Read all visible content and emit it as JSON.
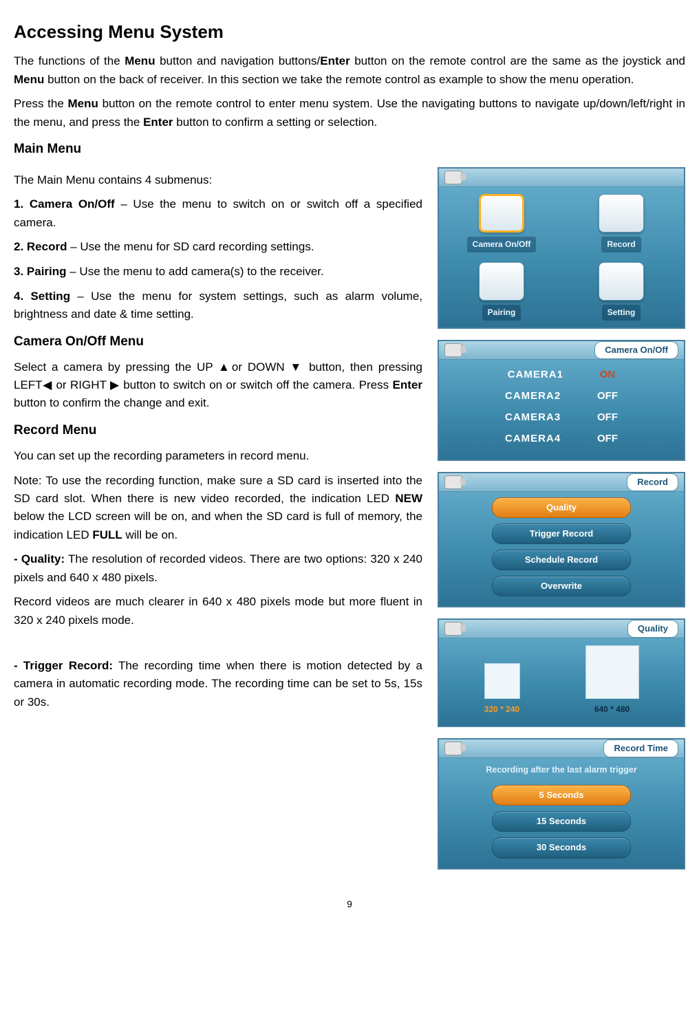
{
  "page_number": "9",
  "title": "Accessing Menu System",
  "intro_p1_run1": "The functions of the ",
  "intro_p1_b1": "Menu",
  "intro_p1_run2": " button and navigation buttons/",
  "intro_p1_b2": "Enter",
  "intro_p1_run3": " button on the remote control are the same as the joystick and ",
  "intro_p1_b3": "Menu",
  "intro_p1_run4": " button on the back of receiver. In this section we take the remote control as example to show the menu operation.",
  "intro_p2_run1": "Press the ",
  "intro_p2_b1": "Menu",
  "intro_p2_run2": " button on the remote control to enter menu system. Use the navigating buttons to navigate up/down/left/right in the menu, and press the ",
  "intro_p2_b2": "Enter",
  "intro_p2_run3": " button to confirm a setting or selection.",
  "h2_main_menu": "Main Menu",
  "main_menu_intro": "The Main Menu contains 4 submenus:",
  "mm_1_b": "1. Camera On/Off",
  "mm_1_t": " – Use the menu to switch on or switch off a specified camera.",
  "mm_2_b": "2. Record",
  "mm_2_t": " – Use the menu for SD card recording settings.",
  "mm_3_b": "3. Pairing",
  "mm_3_t": " – Use the menu to add camera(s) to the receiver.",
  "mm_4_b": "4. Setting",
  "mm_4_t": " – Use the menu for system settings, such as alarm volume, brightness and date & time setting.",
  "h2_cam": "Camera On/Off Menu",
  "cam_p_run1": "Select a camera by pressing the UP ▲or DOWN ▼ button, then pressing LEFT◀ or RIGHT ▶ button to switch on or switch off the camera. Press ",
  "cam_p_b1": "Enter",
  "cam_p_run2": " button to confirm the change and exit.",
  "h2_record": "Record Menu",
  "rec_p1": "You can set up the recording parameters in record menu.",
  "rec_p2_run1": "Note: To use the recording function, make sure a SD card is inserted into the SD card slot. When there is new video recorded, the indication LED ",
  "rec_p2_b1": "NEW",
  "rec_p2_run2": " below the LCD screen will be on, and when the SD card is full of memory, the indication LED ",
  "rec_p2_b2": "FULL",
  "rec_p2_run3": " will be on.",
  "rec_q_b": "- Quality:",
  "rec_q_t": " The resolution of recorded videos. There are two options: 320 x 240 pixels and 640 x 480 pixels.",
  "rec_q2": "Record videos are much clearer in 640 x 480 pixels mode but more fluent in 320 x 240 pixels mode.",
  "rec_tr_b": "- Trigger Record:",
  "rec_tr_t": " The recording time when there is motion detected by a camera in automatic recording mode. The recording time can be set to 5s, 15s or 30s.",
  "screens": {
    "main_menu": {
      "cells": [
        "Camera On/Off",
        "Record",
        "Pairing",
        "Setting"
      ]
    },
    "cam_onoff": {
      "title": "Camera On/Off",
      "rows": [
        {
          "name": "CAMERA1",
          "state": "ON",
          "on": true
        },
        {
          "name": "CAMERA2",
          "state": "OFF",
          "on": false
        },
        {
          "name": "CAMERA3",
          "state": "OFF",
          "on": false
        },
        {
          "name": "CAMERA4",
          "state": "OFF",
          "on": false
        }
      ]
    },
    "record": {
      "title": "Record",
      "items": [
        "Quality",
        "Trigger Record",
        "Schedule Record",
        "Overwrite"
      ]
    },
    "quality": {
      "title": "Quality",
      "opt_a": "320 * 240",
      "opt_b": "640 * 480"
    },
    "record_time": {
      "title": "Record Time",
      "subtitle": "Recording after the last alarm trigger",
      "items": [
        "5 Seconds",
        "15 Seconds",
        "30 Seconds"
      ]
    }
  }
}
